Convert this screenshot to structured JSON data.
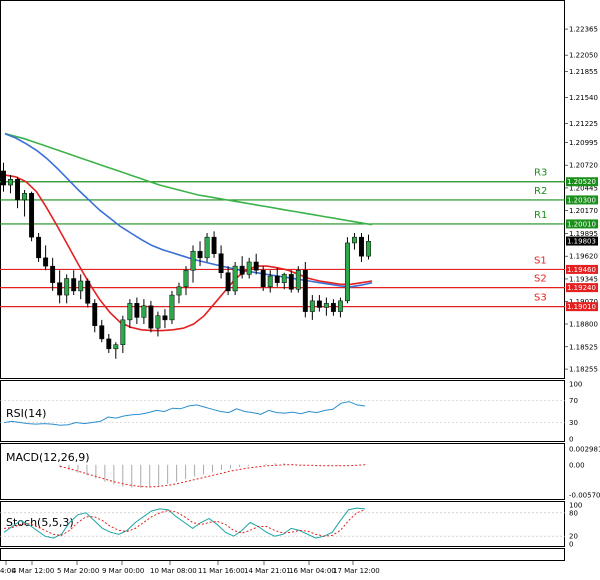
{
  "chart_data": {
    "type": "candlestick",
    "x_labels": [
      "4:00",
      "4 Mar 12:00",
      "5 Mar 20:00",
      "9 Mar 00:00",
      "10 Mar 08:00",
      "11 Mar 16:00",
      "14 Mar 21:01",
      "16 Mar 04:00",
      "17 Mar 12:00"
    ],
    "y_ticks": [
      "1.22365",
      "1.22050",
      "1.21855",
      "1.21540",
      "1.21225",
      "1.20995",
      "1.20720",
      "1.20445",
      "1.20170",
      "1.19895",
      "1.19620",
      "1.19345",
      "1.19070",
      "1.18800",
      "1.18525",
      "1.18255"
    ],
    "ylim": [
      1.1822,
      1.2262
    ],
    "candles": [
      {
        "o": 1.2065,
        "h": 1.2075,
        "l": 1.204,
        "c": 1.2048
      },
      {
        "o": 1.2048,
        "h": 1.206,
        "l": 1.2038,
        "c": 1.2055
      },
      {
        "o": 1.2055,
        "h": 1.2058,
        "l": 1.202,
        "c": 1.203
      },
      {
        "o": 1.203,
        "h": 1.2042,
        "l": 1.201,
        "c": 1.2038
      },
      {
        "o": 1.2038,
        "h": 1.204,
        "l": 1.198,
        "c": 1.1985
      },
      {
        "o": 1.1985,
        "h": 1.199,
        "l": 1.1955,
        "c": 1.196
      },
      {
        "o": 1.196,
        "h": 1.1975,
        "l": 1.1945,
        "c": 1.195
      },
      {
        "o": 1.195,
        "h": 1.196,
        "l": 1.192,
        "c": 1.193
      },
      {
        "o": 1.193,
        "h": 1.1945,
        "l": 1.1905,
        "c": 1.1915
      },
      {
        "o": 1.1915,
        "h": 1.194,
        "l": 1.1905,
        "c": 1.1935
      },
      {
        "o": 1.1935,
        "h": 1.1945,
        "l": 1.1915,
        "c": 1.192
      },
      {
        "o": 1.192,
        "h": 1.194,
        "l": 1.191,
        "c": 1.1932
      },
      {
        "o": 1.1932,
        "h": 1.1935,
        "l": 1.19,
        "c": 1.1905
      },
      {
        "o": 1.1905,
        "h": 1.191,
        "l": 1.187,
        "c": 1.1878
      },
      {
        "o": 1.1878,
        "h": 1.1885,
        "l": 1.1858,
        "c": 1.1862
      },
      {
        "o": 1.1862,
        "h": 1.1868,
        "l": 1.1845,
        "c": 1.185
      },
      {
        "o": 1.185,
        "h": 1.1858,
        "l": 1.1838,
        "c": 1.1855
      },
      {
        "o": 1.1855,
        "h": 1.189,
        "l": 1.1845,
        "c": 1.1885
      },
      {
        "o": 1.1885,
        "h": 1.191,
        "l": 1.1875,
        "c": 1.1905
      },
      {
        "o": 1.1905,
        "h": 1.1912,
        "l": 1.188,
        "c": 1.1888
      },
      {
        "o": 1.1888,
        "h": 1.191,
        "l": 1.188,
        "c": 1.1902
      },
      {
        "o": 1.1902,
        "h": 1.1908,
        "l": 1.187,
        "c": 1.1875
      },
      {
        "o": 1.1875,
        "h": 1.1895,
        "l": 1.1865,
        "c": 1.189
      },
      {
        "o": 1.189,
        "h": 1.1898,
        "l": 1.1875,
        "c": 1.1885
      },
      {
        "o": 1.1885,
        "h": 1.192,
        "l": 1.188,
        "c": 1.1915
      },
      {
        "o": 1.1915,
        "h": 1.193,
        "l": 1.1905,
        "c": 1.1925
      },
      {
        "o": 1.1925,
        "h": 1.195,
        "l": 1.1915,
        "c": 1.1945
      },
      {
        "o": 1.1945,
        "h": 1.1975,
        "l": 1.193,
        "c": 1.1968
      },
      {
        "o": 1.1968,
        "h": 1.198,
        "l": 1.195,
        "c": 1.196
      },
      {
        "o": 1.196,
        "h": 1.199,
        "l": 1.1955,
        "c": 1.1985
      },
      {
        "o": 1.1985,
        "h": 1.1992,
        "l": 1.196,
        "c": 1.1965
      },
      {
        "o": 1.1965,
        "h": 1.1975,
        "l": 1.1935,
        "c": 1.1942
      },
      {
        "o": 1.1942,
        "h": 1.195,
        "l": 1.1915,
        "c": 1.192
      },
      {
        "o": 1.192,
        "h": 1.1955,
        "l": 1.1915,
        "c": 1.195
      },
      {
        "o": 1.195,
        "h": 1.1962,
        "l": 1.1935,
        "c": 1.194
      },
      {
        "o": 1.194,
        "h": 1.196,
        "l": 1.1935,
        "c": 1.1955
      },
      {
        "o": 1.1955,
        "h": 1.1965,
        "l": 1.194,
        "c": 1.1945
      },
      {
        "o": 1.1945,
        "h": 1.195,
        "l": 1.192,
        "c": 1.1925
      },
      {
        "o": 1.1925,
        "h": 1.1945,
        "l": 1.1918,
        "c": 1.1938
      },
      {
        "o": 1.1938,
        "h": 1.1948,
        "l": 1.1925,
        "c": 1.193
      },
      {
        "o": 1.193,
        "h": 1.1942,
        "l": 1.1922,
        "c": 1.194
      },
      {
        "o": 1.194,
        "h": 1.1945,
        "l": 1.1918,
        "c": 1.1922
      },
      {
        "o": 1.1922,
        "h": 1.195,
        "l": 1.1918,
        "c": 1.1945
      },
      {
        "o": 1.1945,
        "h": 1.1955,
        "l": 1.1888,
        "c": 1.1895
      },
      {
        "o": 1.1895,
        "h": 1.1915,
        "l": 1.1885,
        "c": 1.1908
      },
      {
        "o": 1.1908,
        "h": 1.1915,
        "l": 1.1895,
        "c": 1.19
      },
      {
        "o": 1.19,
        "h": 1.1912,
        "l": 1.189,
        "c": 1.1905
      },
      {
        "o": 1.1905,
        "h": 1.191,
        "l": 1.189,
        "c": 1.1895
      },
      {
        "o": 1.1895,
        "h": 1.1912,
        "l": 1.1888,
        "c": 1.1908
      },
      {
        "o": 1.1908,
        "h": 1.1985,
        "l": 1.1905,
        "c": 1.1978
      },
      {
        "o": 1.1978,
        "h": 1.199,
        "l": 1.197,
        "c": 1.1985
      },
      {
        "o": 1.1985,
        "h": 1.199,
        "l": 1.1955,
        "c": 1.1962
      },
      {
        "o": 1.1962,
        "h": 1.1988,
        "l": 1.1958,
        "c": 1.198
      }
    ],
    "ma_green": [
      1.211,
      1.2107,
      1.2104,
      1.21,
      1.2096,
      1.2092,
      1.2088,
      1.2084,
      1.208,
      1.2076,
      1.2072,
      1.2068,
      1.2064,
      1.206,
      1.2056,
      1.2052,
      1.2048,
      1.2045,
      1.2042,
      1.2039,
      1.2036,
      1.2034,
      1.2032,
      1.203,
      1.2028,
      1.2026,
      1.2024,
      1.2022,
      1.202,
      1.2018,
      1.2016,
      1.2014,
      1.2012,
      1.201,
      1.2008,
      1.2006,
      1.2004,
      1.2002,
      1.2
    ],
    "ma_blue": [
      1.211,
      1.2105,
      1.2098,
      1.209,
      1.208,
      1.2068,
      1.2055,
      1.2042,
      1.203,
      1.2018,
      1.2008,
      1.1998,
      1.199,
      1.1982,
      1.1975,
      1.197,
      1.1966,
      1.1962,
      1.1958,
      1.1955,
      1.1952,
      1.1949,
      1.1946,
      1.1944,
      1.1942,
      1.194,
      1.1938,
      1.1936,
      1.1934,
      1.1932,
      1.193,
      1.1928,
      1.1926,
      1.1925,
      1.1927,
      1.193
    ],
    "ma_red": [
      1.206,
      1.2058,
      1.2052,
      1.204,
      1.202,
      1.1998,
      1.1975,
      1.1952,
      1.193,
      1.191,
      1.1894,
      1.1882,
      1.1876,
      1.1873,
      1.1872,
      1.1872,
      1.1873,
      1.1875,
      1.188,
      1.189,
      1.1905,
      1.192,
      1.1935,
      1.1945,
      1.195,
      1.195,
      1.1948,
      1.1945,
      1.194,
      1.1935,
      1.1932,
      1.193,
      1.1928,
      1.1928,
      1.193,
      1.1932
    ],
    "levels": [
      {
        "name": "R3",
        "value": 1.2052,
        "tag": "1.20520",
        "color": "#1a8f1a"
      },
      {
        "name": "R2",
        "value": 1.203,
        "tag": "1.20300",
        "color": "#1a8f1a"
      },
      {
        "name": "R1",
        "value": 1.2001,
        "tag": "1.20010",
        "color": "#1a8f1a"
      },
      {
        "name": "S1",
        "value": 1.1946,
        "tag": "1.19460",
        "color": "#e52020"
      },
      {
        "name": "S2",
        "value": 1.1924,
        "tag": "1.19240",
        "color": "#e52020"
      },
      {
        "name": "S3",
        "value": 1.1901,
        "tag": "1.19010",
        "color": "#e52020"
      }
    ],
    "current_price": {
      "value": 1.19803,
      "tag": "1.19803"
    },
    "rsi": {
      "label": "RSI(14)",
      "ticks": [
        "100",
        "70",
        "30",
        "0"
      ],
      "values": [
        30,
        32,
        30,
        28,
        27,
        28,
        27,
        25,
        26,
        30,
        28,
        30,
        32,
        40,
        38,
        42,
        44,
        45,
        48,
        52,
        50,
        56,
        55,
        60,
        62,
        58,
        54,
        50,
        48,
        55,
        50,
        48,
        45,
        52,
        48,
        47,
        49,
        46,
        50,
        48,
        52,
        54,
        65,
        68,
        62,
        60
      ]
    },
    "macd": {
      "label": "MACD(12,26,9)",
      "ticks": [
        "0.002981",
        "0.00",
        "-0.005708"
      ],
      "hist": [
        -0.0005,
        -0.001,
        -0.0015,
        -0.002,
        -0.0026,
        -0.0032,
        -0.0037,
        -0.0041,
        -0.0043,
        -0.0044,
        -0.0043,
        -0.004,
        -0.0036,
        -0.0032,
        -0.0027,
        -0.0022,
        -0.0018,
        -0.0014,
        -0.001,
        -0.0007,
        -0.0004,
        -0.0002,
        0.0,
        0.0002,
        0.0003,
        0.0003,
        0.0002,
        0.0001,
        0.0,
        -0.0001,
        -0.0002,
        -0.0002,
        -0.0001,
        0.0,
        0.0001
      ],
      "signal": [
        -0.0003,
        -0.0007,
        -0.0012,
        -0.0017,
        -0.0022,
        -0.0027,
        -0.0032,
        -0.0036,
        -0.0039,
        -0.0041,
        -0.0042,
        -0.0041,
        -0.0039,
        -0.0036,
        -0.0032,
        -0.0028,
        -0.0024,
        -0.002,
        -0.0016,
        -0.0012,
        -0.0009,
        -0.0006,
        -0.0004,
        -0.0002,
        -0.0001,
        0.0,
        0.0,
        -0.0001,
        -0.0001,
        -0.0002,
        -0.0002,
        -0.0002,
        -0.0002,
        -0.0001,
        0.0
      ]
    },
    "stoch": {
      "label": "Stoch(5,5,3)",
      "ticks": [
        "100",
        "80",
        "20",
        "0"
      ],
      "main": [
        30,
        45,
        60,
        50,
        35,
        20,
        15,
        25,
        55,
        75,
        80,
        60,
        40,
        30,
        25,
        35,
        55,
        70,
        85,
        90,
        88,
        70,
        55,
        40,
        55,
        65,
        50,
        30,
        20,
        35,
        55,
        45,
        30,
        20,
        25,
        40,
        35,
        25,
        15,
        20,
        30,
        60,
        88,
        92,
        90
      ],
      "signal": [
        40,
        42,
        50,
        52,
        45,
        35,
        25,
        22,
        35,
        55,
        70,
        70,
        60,
        45,
        35,
        32,
        40,
        55,
        70,
        80,
        86,
        82,
        70,
        55,
        50,
        55,
        58,
        50,
        35,
        28,
        35,
        45,
        45,
        35,
        28,
        30,
        35,
        33,
        25,
        20,
        22,
        35,
        60,
        80,
        88
      ]
    }
  }
}
